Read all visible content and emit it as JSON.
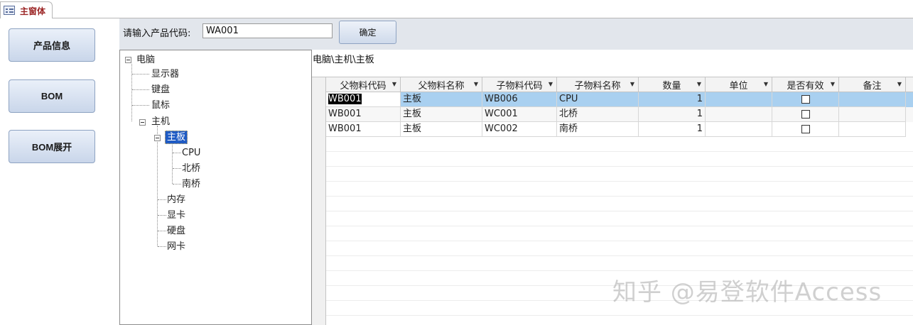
{
  "tab": {
    "title": "主窗体",
    "icon": "form-icon"
  },
  "nav": {
    "product_info": "产品信息",
    "bom": "BOM",
    "bom_expand": "BOM展开"
  },
  "header": {
    "prompt": "请输入产品代码:",
    "code_value": "WA001",
    "confirm_label": "确定"
  },
  "tree": {
    "root": "电脑",
    "monitor": "显示器",
    "keyboard": "键盘",
    "mouse": "鼠标",
    "host": "主机",
    "motherboard": "主板",
    "cpu": "CPU",
    "northbridge": "北桥",
    "southbridge": "南桥",
    "memory": "内存",
    "graphics": "显卡",
    "harddisk": "硬盘",
    "nic": "网卡"
  },
  "breadcrumb": "电脑\\主机\\主板",
  "grid": {
    "columns": [
      "父物料代码",
      "父物料名称",
      "子物料代码",
      "子物料名称",
      "数量",
      "单位",
      "是否有效",
      "备注"
    ],
    "rows": [
      {
        "parent_code": "WB001",
        "parent_name": "主板",
        "child_code": "WB006",
        "child_name": "CPU",
        "qty": "1",
        "unit": "",
        "valid": false,
        "note": ""
      },
      {
        "parent_code": "WB001",
        "parent_name": "主板",
        "child_code": "WC001",
        "child_name": "北桥",
        "qty": "1",
        "unit": "",
        "valid": false,
        "note": ""
      },
      {
        "parent_code": "WB001",
        "parent_name": "主板",
        "child_code": "WC002",
        "child_name": "南桥",
        "qty": "1",
        "unit": "",
        "valid": false,
        "note": ""
      }
    ]
  },
  "watermark": "知乎 @易登软件Access"
}
